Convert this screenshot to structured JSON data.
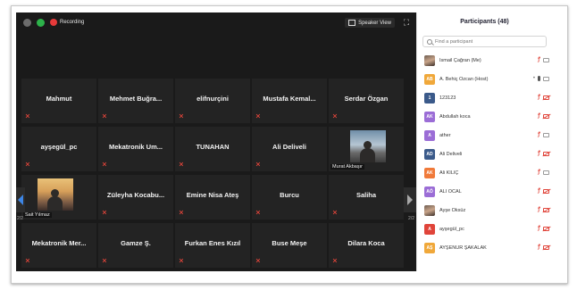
{
  "topbar": {
    "recording_label": "Recording",
    "view_label": "Speaker View"
  },
  "tiles": [
    {
      "row": 0,
      "col": 0,
      "name": "Mahmut",
      "muted": true
    },
    {
      "row": 0,
      "col": 1,
      "name": "Mehmet Buğra...",
      "muted": true
    },
    {
      "row": 0,
      "col": 2,
      "name": "elifnurçini",
      "muted": true
    },
    {
      "row": 0,
      "col": 3,
      "name": "Mustafa Kemal...",
      "muted": true
    },
    {
      "row": 0,
      "col": 4,
      "name": "Serdar Özgan",
      "muted": true
    },
    {
      "row": 1,
      "col": 0,
      "name": "ayşegül_pc",
      "muted": true
    },
    {
      "row": 1,
      "col": 1,
      "name": "Mekatronik Um...",
      "muted": true
    },
    {
      "row": 1,
      "col": 2,
      "name": "TUNAHAN",
      "muted": true
    },
    {
      "row": 1,
      "col": 3,
      "name": "Ali Deliveli",
      "muted": true
    },
    {
      "row": 1,
      "col": 4,
      "name": "",
      "muted": false,
      "video": true,
      "video_label": "Murat Akbaşır"
    },
    {
      "row": 2,
      "col": 0,
      "name": "",
      "muted": false,
      "video": true,
      "video_label": "Sait Yılmaz"
    },
    {
      "row": 2,
      "col": 1,
      "name": "Züleyha Kocabu...",
      "muted": true
    },
    {
      "row": 2,
      "col": 2,
      "name": "Emine Nisa Ateş",
      "muted": true
    },
    {
      "row": 2,
      "col": 3,
      "name": "Burcu",
      "muted": true
    },
    {
      "row": 2,
      "col": 4,
      "name": "Saliha",
      "muted": true
    },
    {
      "row": 3,
      "col": 0,
      "name": "Mekatronik Mer...",
      "muted": true
    },
    {
      "row": 3,
      "col": 1,
      "name": "Gamze Ş.",
      "muted": true
    },
    {
      "row": 3,
      "col": 2,
      "name": "Furkan Enes Kızıl",
      "muted": true
    },
    {
      "row": 3,
      "col": 3,
      "name": "Buse Meşe",
      "muted": true
    },
    {
      "row": 3,
      "col": 4,
      "name": "Dilara Koca",
      "muted": true
    }
  ],
  "pager": {
    "left": "2/2",
    "right": "2/2"
  },
  "panel": {
    "title": "Participants (48)",
    "search_placeholder": "Find a participant",
    "participants": [
      {
        "initials": "",
        "photo": true,
        "color": "",
        "name": "İsmail Çağran (Me)",
        "status": "mic-off-cam-gray"
      },
      {
        "initials": "AB",
        "color": "#f0a83a",
        "name": "A. Behiç Ozcan (Host)",
        "status": "host"
      },
      {
        "initials": "1",
        "color": "#3b5a8a",
        "name": "123123",
        "status": "mic-off-cam-off"
      },
      {
        "initials": "AK",
        "color": "#9b6dd6",
        "name": "Abdullah koca",
        "status": "mic-off-cam-off"
      },
      {
        "initials": "A",
        "color": "#9b6dd6",
        "name": "ather",
        "status": "mic-off-cam-gray"
      },
      {
        "initials": "AD",
        "color": "#3b5a8a",
        "name": "Ali Deliveli",
        "status": "mic-off-cam-off"
      },
      {
        "initials": "AK",
        "color": "#f07a3a",
        "name": "Ali KILIÇ",
        "status": "mic-off-cam-gray"
      },
      {
        "initials": "AÖ",
        "color": "#9b6dd6",
        "name": "ALİ ÖCAL",
        "status": "mic-off-cam-off"
      },
      {
        "initials": "",
        "photo": true,
        "color": "",
        "name": "Ayşe Öksüz",
        "status": "mic-off-cam-off"
      },
      {
        "initials": "A",
        "color": "#e0443a",
        "name": "ayşegül_pc",
        "status": "mic-off-cam-off"
      },
      {
        "initials": "AŞ",
        "color": "#f0a83a",
        "name": "AYŞENUR ŞAKALAK",
        "status": "mic-off-cam-off"
      }
    ]
  }
}
